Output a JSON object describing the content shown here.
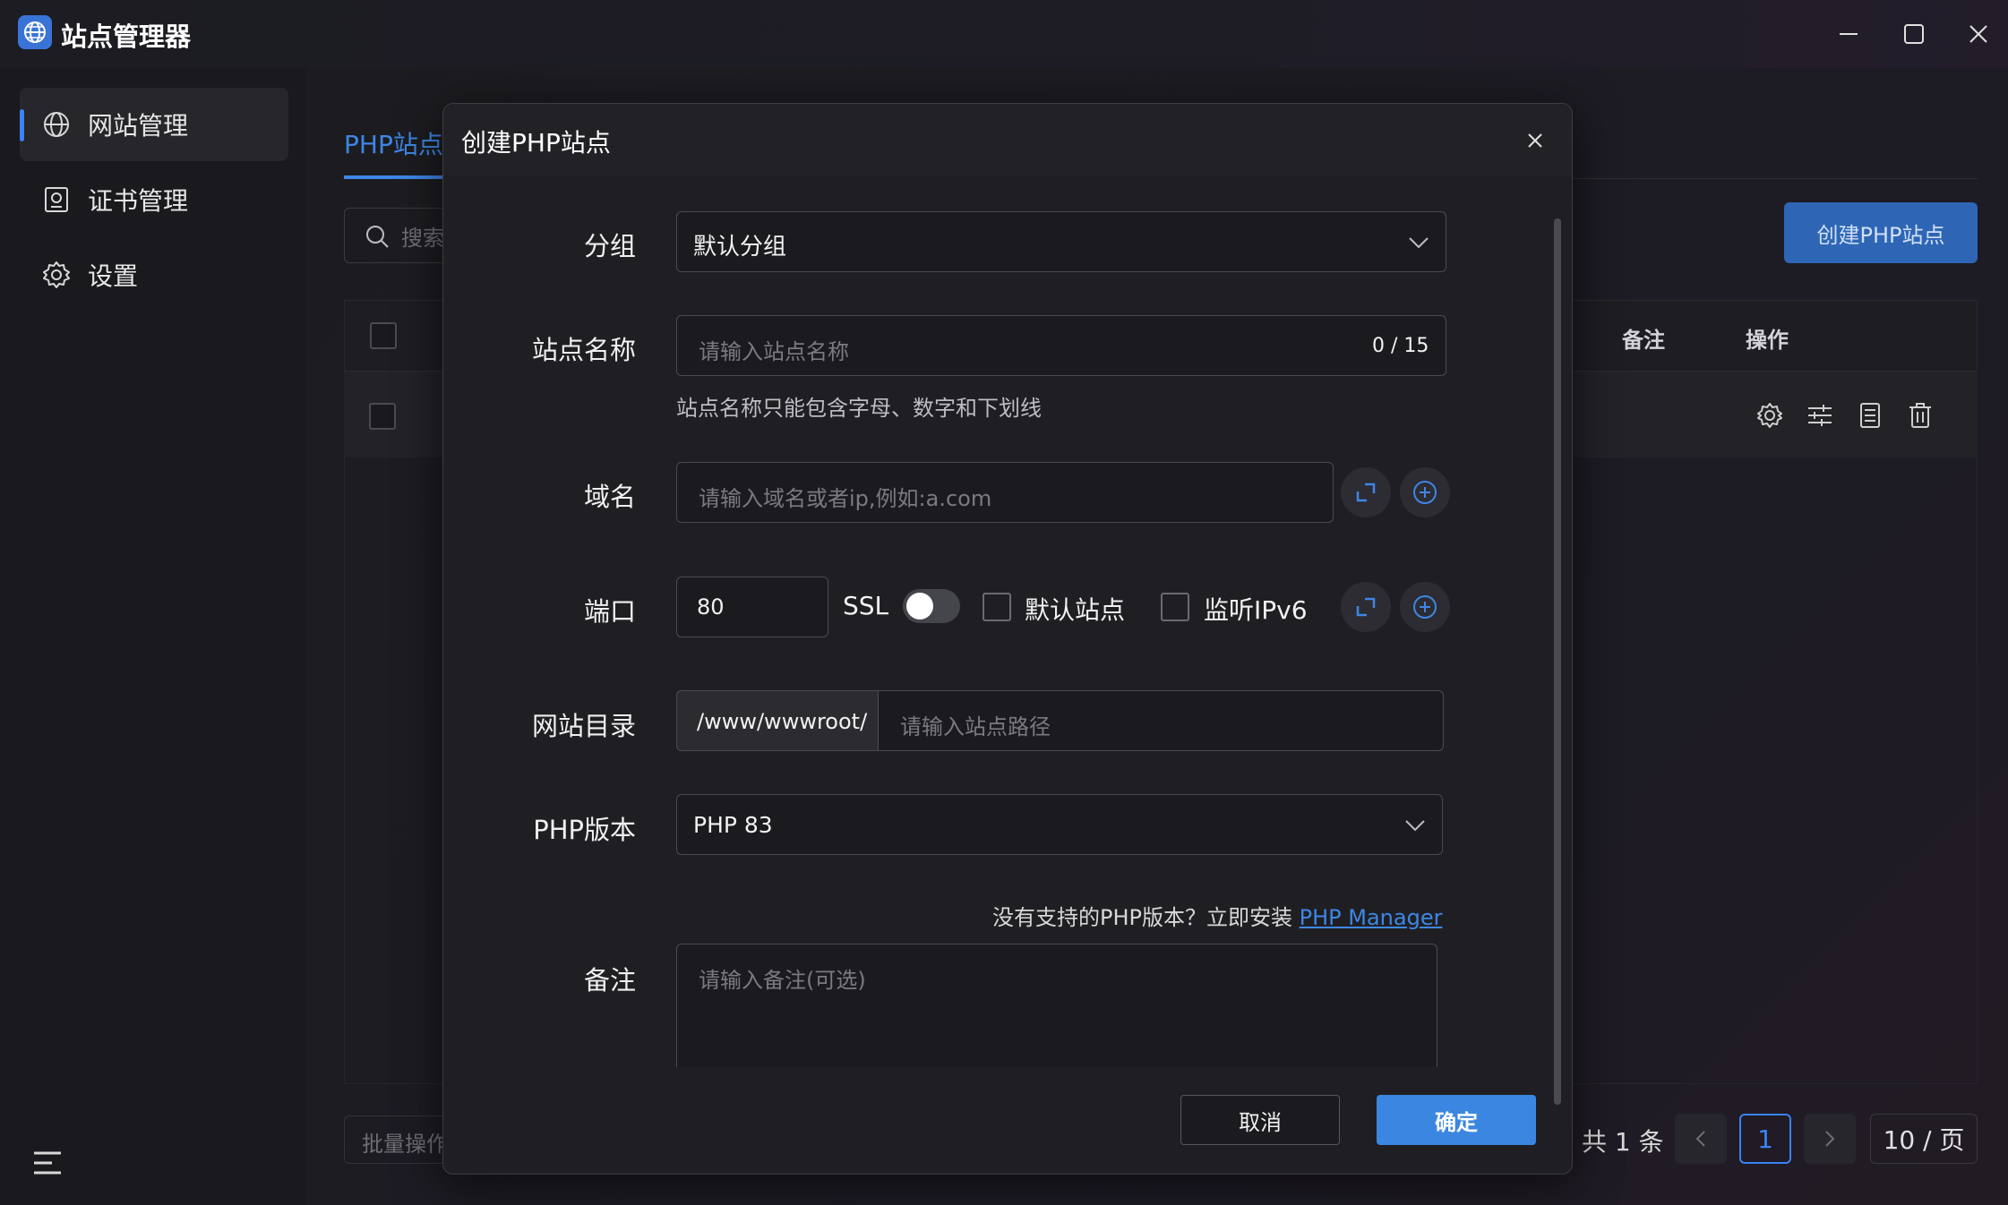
{
  "app": {
    "title": "站点管理器",
    "icon": "globe-icon"
  },
  "sidebar": {
    "items": [
      {
        "label": "网站管理",
        "icon": "globe-icon",
        "active": true
      },
      {
        "label": "证书管理",
        "icon": "certificate-icon",
        "active": false
      },
      {
        "label": "设置",
        "icon": "gear-icon",
        "active": false
      }
    ]
  },
  "main": {
    "tab_label": "PHP站点",
    "search_placeholder": "搜索",
    "create_button": "创建PHP站点",
    "columns": {
      "remark": "备注",
      "actions": "操作"
    },
    "batch_label": "批量操作",
    "pagination": {
      "total": "共 1 条",
      "current_page": "1",
      "page_size": "10 / 页"
    }
  },
  "modal": {
    "title": "创建PHP站点",
    "group": {
      "label": "分组",
      "value": "默认分组"
    },
    "site_name": {
      "label": "站点名称",
      "placeholder": "请输入站点名称",
      "counter": "0 / 15",
      "hint": "站点名称只能包含字母、数字和下划线"
    },
    "domain": {
      "label": "域名",
      "placeholder": "请输入域名或者ip,例如:a.com"
    },
    "port": {
      "label": "端口",
      "value": "80",
      "ssl_label": "SSL",
      "ssl_on": false,
      "default_site_label": "默认站点",
      "ipv6_label": "监听IPv6"
    },
    "directory": {
      "label": "网站目录",
      "prefix": "/www/wwwroot/",
      "placeholder": "请输入站点路径"
    },
    "php_version": {
      "label": "PHP版本",
      "value": "PHP 83"
    },
    "php_hint": {
      "text": "没有支持的PHP版本？立即安装",
      "link": "PHP Manager"
    },
    "remark": {
      "label": "备注",
      "placeholder": "请输入备注(可选)"
    },
    "cancel_button": "取消",
    "confirm_button": "确定"
  },
  "colors": {
    "accent": "#3b82f6",
    "primary_button": "#3b86e0"
  }
}
